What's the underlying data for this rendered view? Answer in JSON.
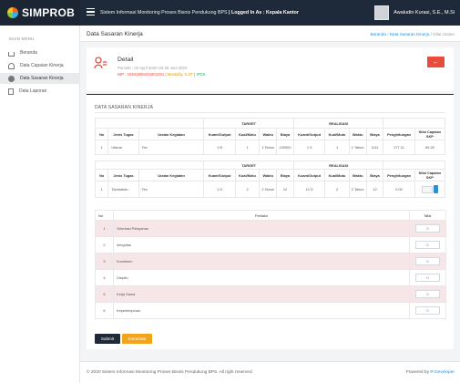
{
  "app": {
    "brand": "SIMPROB",
    "system_title": "Sistem Informasi Monitoring Proses Bisnis Pendukung BPS",
    "logged_in": "| Logged In As : Kepala Kantor",
    "user_name": "Awaludin Kurasi, S.E., M.Si"
  },
  "sidebar": {
    "heading": "MAIN MENU",
    "items": [
      {
        "label": "Beranda"
      },
      {
        "label": "Data Capaian Kinerja"
      },
      {
        "label": "Data Sasaran Kinerja"
      },
      {
        "label": "Data Laporan"
      }
    ],
    "active_index": 2
  },
  "page": {
    "title": "Data Sasaran Kinerja",
    "breadcrumb": [
      "Beranda",
      "Data Sasaran Kinerja",
      "Nilai Uraian"
    ]
  },
  "detail": {
    "title": "Detail",
    "period": "Periode : 04 April 2020 s/d 06 Juni 2020",
    "nip_label": "NIP : 19941806201801001",
    "name": "Mustafiq, S.ST",
    "dept": "IPDS",
    "back_icon": "arrow-left-icon"
  },
  "section_title": "DATA SASARAN KINERJA",
  "table1": {
    "groups": {
      "target": "TARGET",
      "realisasi": "REALISASI"
    },
    "headers": [
      "No",
      "Jenis Tugas",
      "Uraian Kegiatan",
      "Kuant/Output",
      "Kual/Mutu",
      "Waktu",
      "Biaya",
      "Kuant/Output",
      "Kual/Mutu",
      "Waktu",
      "Biaya",
      "Penghitungan",
      "Nilai Capaian SKP"
    ],
    "row": {
      "no": "1",
      "jenis": "Utama",
      "uraian": "Tes",
      "t_kuant": "1 B",
      "t_kual": "1",
      "t_waktu": "1 Tahun",
      "t_biaya": "100000",
      "r_kuant": "1 3",
      "r_kual": "1",
      "r_waktu": "1 Tahun",
      "r_biaya": "1111",
      "hitung": "277.11",
      "nilai": "69.28"
    }
  },
  "table2": {
    "groups": {
      "target": "TARGET",
      "realisasi": "REALISASI"
    },
    "headers": [
      "No",
      "Jenis Tugas",
      "Uraian Kegiatan",
      "Kuant/Output",
      "Kual/Mutu",
      "Waktu",
      "Biaya",
      "Kuant/Output",
      "Kual/Mutu",
      "Waktu",
      "Biaya",
      "Penghitungan",
      "Nilai Capaian SKP"
    ],
    "row": {
      "no": "1",
      "jenis": "Tambahan",
      "uraian": "Tes",
      "t_kuant": "1 D",
      "t_kual": "2",
      "t_waktu": "2 Tahun",
      "t_biaya": "12",
      "r_kuant": "12 D",
      "r_kual": "2",
      "r_waktu": "2 Tahun",
      "r_biaya": "12",
      "hitung": "0.00"
    }
  },
  "perilaku": {
    "headers": {
      "no": "No",
      "perilaku": "Perilaku",
      "nilai": "Nilai"
    },
    "rows": [
      {
        "no": "1",
        "label": "Orientasi Pelayanan",
        "nilai": "0"
      },
      {
        "no": "2",
        "label": "Integritas",
        "nilai": "0"
      },
      {
        "no": "3",
        "label": "Komitmen",
        "nilai": "0"
      },
      {
        "no": "4",
        "label": "Disiplin",
        "nilai": "0"
      },
      {
        "no": "5",
        "label": "Kerja Sama",
        "nilai": "0"
      },
      {
        "no": "6",
        "label": "Kepemimpinan",
        "nilai": "0"
      }
    ]
  },
  "buttons": {
    "submit": "Submit",
    "komentar": "Komentar"
  },
  "footer": {
    "left": "© 2020 Sistem Informasi Monitoring Proses Bisnis Pendukung BPS. All right reserved",
    "right_prefix": "Powered by",
    "right_link": "R Developer"
  },
  "colors": {
    "topbar": "#1e2a3a",
    "accent_red": "#e74c3c",
    "accent_blue": "#2b8fd6",
    "accent_orange": "#f2a51c",
    "row_pink": "#f6e6e7"
  }
}
